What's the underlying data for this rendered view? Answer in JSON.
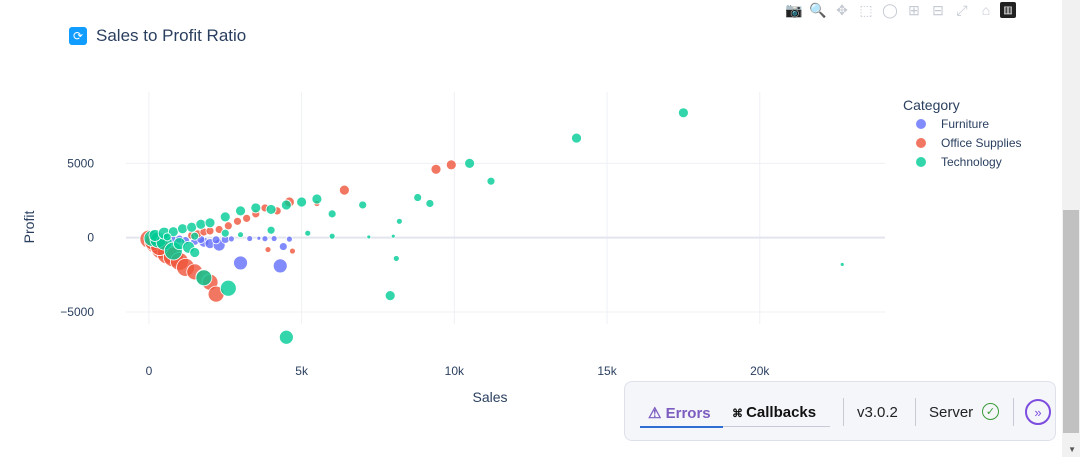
{
  "page": {
    "title": "Sales to Profit Ratio",
    "title_icon": "refresh-icon"
  },
  "modebar": {
    "icons": [
      "camera-icon",
      "zoom-icon",
      "pan-icon",
      "box-select-icon",
      "lasso-icon",
      "zoom-in-icon",
      "zoom-out-icon",
      "autoscale-icon",
      "reset-axes-icon",
      "plotly-logo-icon"
    ]
  },
  "chart_data": {
    "type": "scatter",
    "xlabel": "Sales",
    "ylabel": "Profit",
    "xlim": [
      -750,
      24100
    ],
    "ylim": [
      -8500,
      9800
    ],
    "xticks": [
      0,
      5000,
      10000,
      15000,
      20000
    ],
    "xtick_labels": [
      "0",
      "5k",
      "10k",
      "15k",
      "20k"
    ],
    "yticks": [
      -5000,
      0,
      5000
    ],
    "ytick_labels": [
      "−5000",
      "0",
      "5000"
    ],
    "grid": true,
    "legend": {
      "title": "Category",
      "placement": "right"
    },
    "series": [
      {
        "name": "Furniture",
        "color": "#636efa",
        "points": [
          [
            300,
            -80,
            4
          ],
          [
            500,
            -120,
            4
          ],
          [
            800,
            -150,
            4
          ],
          [
            1000,
            -100,
            4
          ],
          [
            1200,
            -200,
            4
          ],
          [
            1500,
            -250,
            4
          ],
          [
            1800,
            -300,
            5
          ],
          [
            2000,
            -400,
            5
          ],
          [
            2300,
            -500,
            6
          ],
          [
            2500,
            -120,
            4
          ],
          [
            2700,
            -80,
            3
          ],
          [
            3000,
            -1700,
            7
          ],
          [
            4300,
            -1900,
            7
          ],
          [
            4400,
            -600,
            4
          ],
          [
            4600,
            -100,
            3
          ],
          [
            1700,
            -120,
            4
          ],
          [
            2200,
            -150,
            4
          ],
          [
            3300,
            -60,
            3
          ],
          [
            3800,
            -70,
            3
          ],
          [
            4100,
            -60,
            3
          ],
          [
            3600,
            -40,
            2
          ]
        ]
      },
      {
        "name": "Office Supplies",
        "color": "#ef553b",
        "points": [
          [
            0,
            -100,
            9
          ],
          [
            200,
            -350,
            10
          ],
          [
            400,
            -750,
            10
          ],
          [
            600,
            -1100,
            10
          ],
          [
            800,
            -1300,
            10
          ],
          [
            1000,
            -1600,
            9
          ],
          [
            1200,
            -2000,
            9
          ],
          [
            1500,
            -2300,
            8
          ],
          [
            1800,
            -2650,
            8
          ],
          [
            2000,
            -3000,
            8
          ],
          [
            2200,
            -3800,
            8
          ],
          [
            150,
            -250,
            9
          ],
          [
            350,
            -600,
            9
          ],
          [
            1400,
            150,
            4
          ],
          [
            1600,
            260,
            4
          ],
          [
            1800,
            380,
            4
          ],
          [
            2000,
            450,
            4
          ],
          [
            2300,
            550,
            4
          ],
          [
            2600,
            800,
            4
          ],
          [
            2900,
            1100,
            4
          ],
          [
            3200,
            1300,
            4
          ],
          [
            3500,
            1600,
            4
          ],
          [
            3800,
            2000,
            4
          ],
          [
            4200,
            1800,
            4
          ],
          [
            4600,
            2400,
            5
          ],
          [
            5500,
            2300,
            3
          ],
          [
            6400,
            3200,
            5
          ],
          [
            3900,
            -800,
            3
          ],
          [
            4700,
            -900,
            3
          ],
          [
            9400,
            4600,
            5
          ],
          [
            9900,
            4900,
            5
          ]
        ]
      },
      {
        "name": "Technology",
        "color": "#00cc96",
        "points": [
          [
            100,
            -50,
            8
          ],
          [
            300,
            -150,
            8
          ],
          [
            500,
            -300,
            8
          ],
          [
            800,
            -900,
            9
          ],
          [
            1000,
            -400,
            6
          ],
          [
            1300,
            -650,
            6
          ],
          [
            1500,
            -1000,
            5
          ],
          [
            1800,
            -2700,
            8
          ],
          [
            2600,
            -3400,
            8
          ],
          [
            4500,
            -6700,
            7
          ],
          [
            7900,
            -3900,
            5
          ],
          [
            8100,
            -1400,
            3
          ],
          [
            200,
            150,
            6
          ],
          [
            500,
            300,
            6
          ],
          [
            800,
            400,
            5
          ],
          [
            1100,
            600,
            5
          ],
          [
            1400,
            700,
            5
          ],
          [
            1700,
            900,
            5
          ],
          [
            2000,
            1000,
            5
          ],
          [
            2500,
            1400,
            5
          ],
          [
            3000,
            1800,
            5
          ],
          [
            3500,
            2000,
            5
          ],
          [
            4000,
            1900,
            5
          ],
          [
            4500,
            2200,
            5
          ],
          [
            5000,
            2400,
            5
          ],
          [
            5500,
            2600,
            5
          ],
          [
            6000,
            1600,
            4
          ],
          [
            7000,
            2200,
            4
          ],
          [
            8200,
            1100,
            3
          ],
          [
            8800,
            2700,
            4
          ],
          [
            9200,
            2300,
            4
          ],
          [
            10500,
            5000,
            5
          ],
          [
            11200,
            3800,
            4
          ],
          [
            14000,
            6700,
            5
          ],
          [
            17500,
            8400,
            5
          ],
          [
            22700,
            -1800,
            2
          ],
          [
            2500,
            300,
            4
          ],
          [
            4000,
            500,
            4
          ],
          [
            5200,
            300,
            3
          ],
          [
            6000,
            100,
            3
          ],
          [
            7200,
            50,
            2
          ],
          [
            8000,
            100,
            2
          ],
          [
            600,
            50,
            4
          ],
          [
            1500,
            100,
            4
          ],
          [
            3000,
            200,
            3
          ]
        ]
      }
    ]
  },
  "devtools": {
    "errors_label": "Errors",
    "callbacks_label": "Callbacks",
    "version": "v3.0.2",
    "server_label": "Server"
  }
}
